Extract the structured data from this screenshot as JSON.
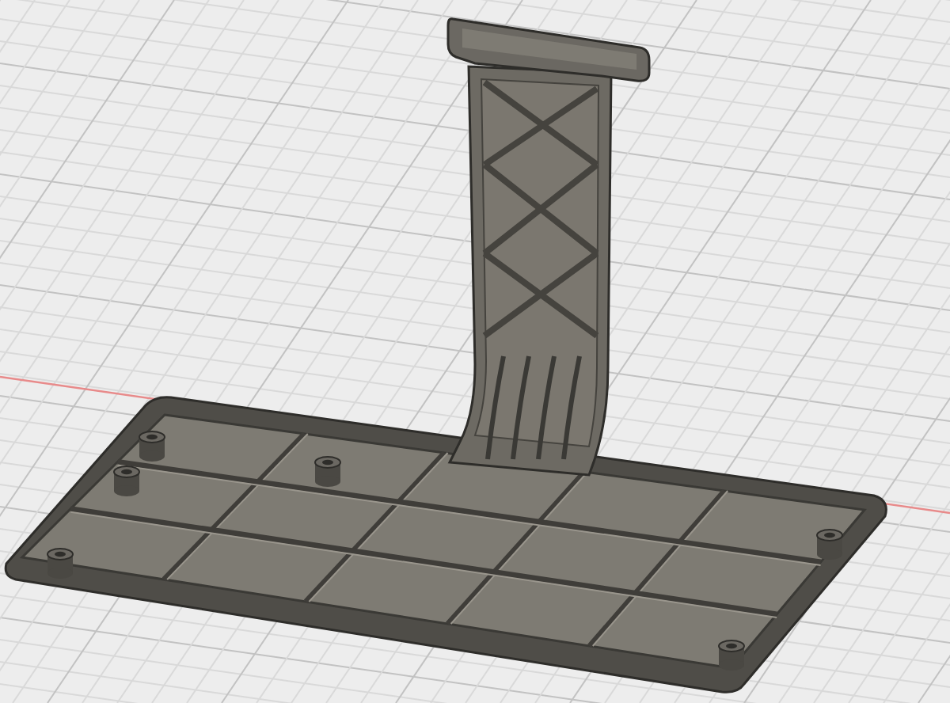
{
  "viewport": {
    "grid_visible": true,
    "model_visible": true
  }
}
